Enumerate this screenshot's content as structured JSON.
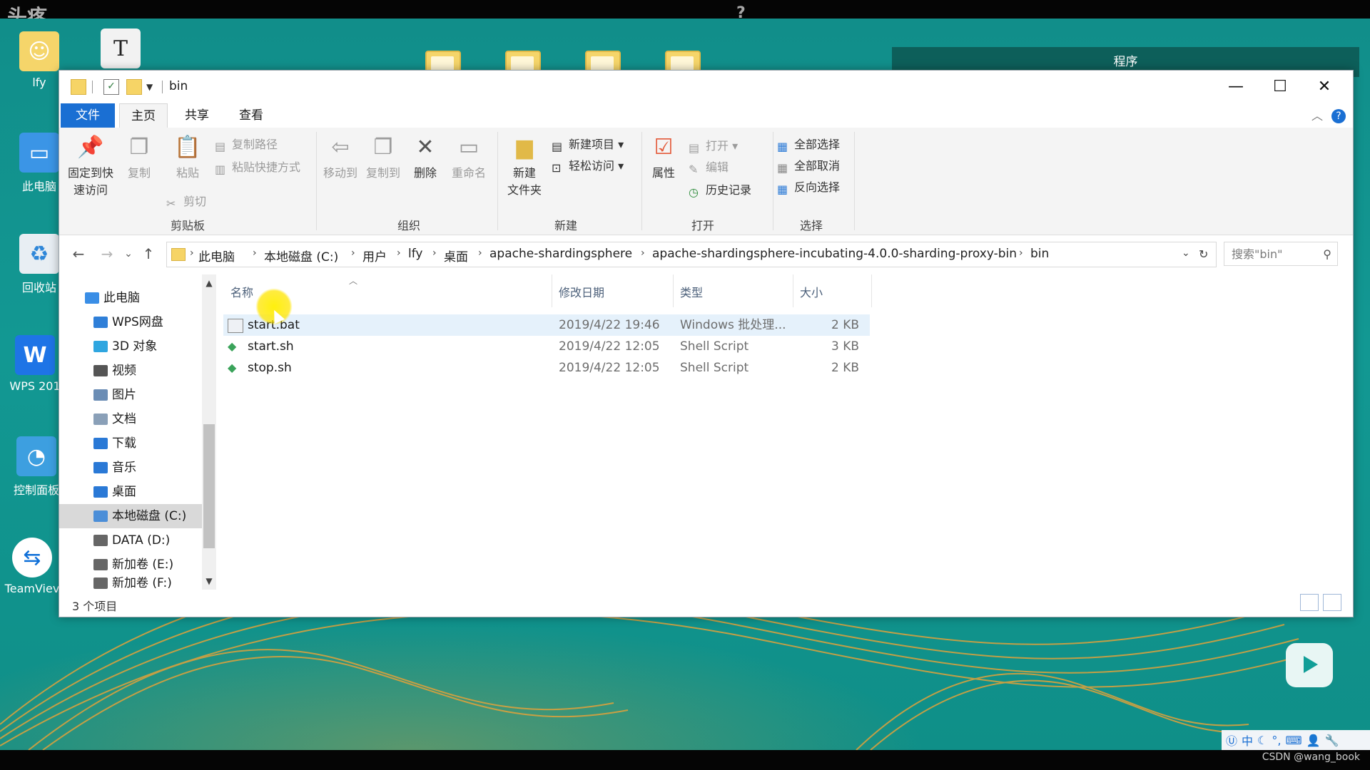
{
  "overlay": {
    "watermark": "头疼",
    "question_mark": "?",
    "credit": "CSDN @wang_book"
  },
  "desktop": {
    "program_bar_label": "程序",
    "icons": [
      {
        "label": "lfy",
        "icon": "user-folder-icon"
      },
      {
        "label": "此电脑",
        "icon": "computer-icon"
      },
      {
        "label": "回收站",
        "icon": "recycle-bin-icon"
      },
      {
        "label": "WPS 201",
        "icon": "wps-icon"
      },
      {
        "label": "控制面板",
        "icon": "control-panel-icon"
      },
      {
        "label": "TeamViev",
        "icon": "teamviewer-icon"
      }
    ],
    "top_shortcut_glyph": "T"
  },
  "window": {
    "title": "bin",
    "tabs": {
      "file": "文件",
      "home": "主页",
      "share": "共享",
      "view": "查看"
    },
    "ribbon": {
      "clipboard": {
        "pin": "固定到快\n速访问",
        "copy": "复制",
        "paste": "粘贴",
        "copy_path": "复制路径",
        "paste_shortcut": "粘贴快捷方式",
        "cut": "剪切",
        "label": "剪贴板"
      },
      "organize": {
        "move_to": "移动到",
        "copy_to": "复制到",
        "delete": "删除",
        "rename": "重命名",
        "label": "组织"
      },
      "new": {
        "new_folder": "新建\n文件夹",
        "new_item": "新建项目",
        "easy_access": "轻松访问",
        "label": "新建"
      },
      "open": {
        "properties": "属性",
        "open": "打开",
        "edit": "编辑",
        "history": "历史记录",
        "label": "打开"
      },
      "select": {
        "select_all": "全部选择",
        "select_none": "全部取消",
        "invert": "反向选择",
        "label": "选择"
      }
    },
    "address": {
      "crumbs": [
        "此电脑",
        "本地磁盘 (C:)",
        "用户",
        "lfy",
        "桌面",
        "apache-shardingsphere",
        "apache-shardingsphere-incubating-4.0.0-sharding-proxy-bin",
        "bin"
      ]
    },
    "search": {
      "placeholder": "搜索\"bin\""
    },
    "nav": [
      {
        "label": "此电脑",
        "icon": "computer-icon",
        "color": "#3a8ee6"
      },
      {
        "label": "WPS网盘",
        "icon": "cloud-icon",
        "color": "#2f7fd8"
      },
      {
        "label": "3D 对象",
        "icon": "cube-icon",
        "color": "#2fa6e0"
      },
      {
        "label": "视频",
        "icon": "video-icon",
        "color": "#555555"
      },
      {
        "label": "图片",
        "icon": "picture-icon",
        "color": "#6b8db5"
      },
      {
        "label": "文档",
        "icon": "document-icon",
        "color": "#8aa0b8"
      },
      {
        "label": "下载",
        "icon": "download-icon",
        "color": "#2a79d6"
      },
      {
        "label": "音乐",
        "icon": "music-icon",
        "color": "#2a79d6"
      },
      {
        "label": "桌面",
        "icon": "desktop-icon",
        "color": "#2a79d6"
      },
      {
        "label": "本地磁盘 (C:)",
        "icon": "drive-c-icon",
        "color": "#4b8ed8"
      },
      {
        "label": "DATA (D:)",
        "icon": "drive-icon",
        "color": "#666666"
      },
      {
        "label": "新加卷 (E:)",
        "icon": "drive-icon",
        "color": "#666666"
      },
      {
        "label": "新加卷 (F:)",
        "icon": "drive-icon",
        "color": "#666666"
      }
    ],
    "columns": {
      "name": "名称",
      "modified": "修改日期",
      "type": "类型",
      "size": "大小"
    },
    "files": [
      {
        "name": "start.bat",
        "modified": "2019/4/22 19:46",
        "type": "Windows 批处理...",
        "size": "2 KB",
        "icon": "batch-file-icon"
      },
      {
        "name": "start.sh",
        "modified": "2019/4/22 12:05",
        "type": "Shell Script",
        "size": "3 KB",
        "icon": "shell-script-icon"
      },
      {
        "name": "stop.sh",
        "modified": "2019/4/22 12:05",
        "type": "Shell Script",
        "size": "2 KB",
        "icon": "shell-script-icon"
      }
    ],
    "status": "3 个项目"
  },
  "taskbar_ime": {
    "lang": "中"
  }
}
